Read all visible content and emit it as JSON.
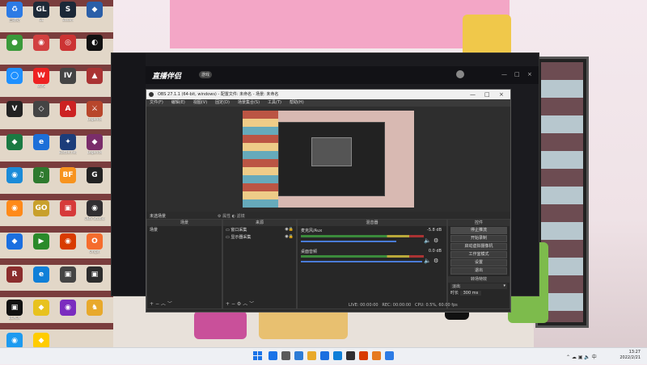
{
  "desktop_icons": [
    {
      "label": "回收站",
      "color": "#2c7be5",
      "glyph": "♻"
    },
    {
      "label": "GL",
      "color": "#1e2a38",
      "glyph": "GL"
    },
    {
      "label": "Steam",
      "color": "#1b2838",
      "glyph": "S"
    },
    {
      "label": "",
      "color": "#2b5fa8",
      "glyph": "◆"
    },
    {
      "label": "",
      "color": "#3a9a3a",
      "glyph": "●"
    },
    {
      "label": "",
      "color": "#d24040",
      "glyph": "◉"
    },
    {
      "label": "",
      "color": "#c33",
      "glyph": "◎"
    },
    {
      "label": "",
      "color": "#111",
      "glyph": "◐"
    },
    {
      "label": "",
      "color": "#1e90ff",
      "glyph": "◯"
    },
    {
      "label": "WPS",
      "color": "#e22",
      "glyph": "W"
    },
    {
      "label": "",
      "color": "#444",
      "glyph": "IV"
    },
    {
      "label": "",
      "color": "#a33",
      "glyph": "▲"
    },
    {
      "label": "",
      "color": "#222",
      "glyph": "V"
    },
    {
      "label": "",
      "color": "#444",
      "glyph": "◇"
    },
    {
      "label": "",
      "color": "#c22",
      "glyph": "A"
    },
    {
      "label": "Legends",
      "color": "#b8462b",
      "glyph": "⚔"
    },
    {
      "label": "",
      "color": "#1a7a42",
      "glyph": "◆"
    },
    {
      "label": "",
      "color": "#1d6fd8",
      "glyph": "e"
    },
    {
      "label": "Battle.net",
      "color": "#1c3d7a",
      "glyph": "✦"
    },
    {
      "label": "Legends",
      "color": "#7a2d6a",
      "glyph": "◆"
    },
    {
      "label": "",
      "color": "#1a8bd8",
      "glyph": "◉"
    },
    {
      "label": "",
      "color": "#2e7a2e",
      "glyph": "♫"
    },
    {
      "label": "",
      "color": "#f7931e",
      "glyph": "BF"
    },
    {
      "label": "",
      "color": "#222",
      "glyph": "G"
    },
    {
      "label": "",
      "color": "#ff8a1a",
      "glyph": "◉"
    },
    {
      "label": "",
      "color": "#c8a02c",
      "glyph": "GO"
    },
    {
      "label": "",
      "color": "#d63a3a",
      "glyph": "▣"
    },
    {
      "label": "OBS Studio",
      "color": "#302e31",
      "glyph": "◉"
    },
    {
      "label": "",
      "color": "#1b6fe0",
      "glyph": "◆"
    },
    {
      "label": "",
      "color": "#2a8a2a",
      "glyph": "▶"
    },
    {
      "label": "",
      "color": "#d83b01",
      "glyph": "◉"
    },
    {
      "label": "Origin",
      "color": "#f56c2d",
      "glyph": "O"
    },
    {
      "label": "",
      "color": "#8b2d2d",
      "glyph": "R"
    },
    {
      "label": "",
      "color": "#0f7fd8",
      "glyph": "e"
    },
    {
      "label": "",
      "color": "#444",
      "glyph": "▣"
    },
    {
      "label": "",
      "color": "#2c2c2c",
      "glyph": "▣"
    },
    {
      "label": "BLACK",
      "color": "#111",
      "glyph": "▣"
    },
    {
      "label": "",
      "color": "#e8c21e",
      "glyph": "◆"
    },
    {
      "label": "",
      "color": "#7b2cbf",
      "glyph": "◉"
    },
    {
      "label": "",
      "color": "#e8a92b",
      "glyph": "♞"
    },
    {
      "label": "",
      "color": "#1d9bf0",
      "glyph": "◉"
    },
    {
      "label": "",
      "color": "#ffcc00",
      "glyph": "◆"
    }
  ],
  "live_app": {
    "title": "直播伴侣",
    "badge": "游戏"
  },
  "obs": {
    "title": "OBS 27.1.1 (64-bit, windows) - 配置文件: 未命名 - 场景: 未命名",
    "menu": [
      "文件(F)",
      "编辑(E)",
      "视图(V)",
      "固定(D)",
      "场景集合(S)",
      "工具(T)",
      "帮助(H)"
    ],
    "scene_name": "未选场景",
    "mini_buttons": [
      "属性",
      "滤镜"
    ],
    "docks": {
      "scenes": {
        "title": "场景",
        "items": [
          "场景"
        ]
      },
      "sources": {
        "title": "来源",
        "items": [
          "窗口采集",
          "显示器采集"
        ]
      },
      "mixer": {
        "title": "混音器",
        "tracks": [
          {
            "name": "麦克风/Aux",
            "db": "-5.8 dB"
          },
          {
            "name": "桌面音频",
            "db": "0.0 dB"
          }
        ]
      },
      "controls": {
        "title": "控件",
        "buttons": [
          "停止推流",
          "开始录制",
          "启动虚拟摄像机",
          "工作室模式",
          "设置",
          "退出"
        ],
        "transitions_label": "转场特效",
        "transition_value": "淡出",
        "duration_label": "时长",
        "duration_value": "300 ms"
      }
    },
    "status": {
      "live": "LIVE: 00:00:00",
      "rec": "REC: 00:00:00",
      "cpu": "CPU: 0.5%, 60.00 fps"
    }
  },
  "taskbar": {
    "time": "13:27",
    "date": "2022/2/21",
    "apps": [
      {
        "color": "#1a73e8"
      },
      {
        "color": "#5b5b5b"
      },
      {
        "color": "#2d7cd6"
      },
      {
        "color": "#e8a92b"
      },
      {
        "color": "#1b6fe0"
      },
      {
        "color": "#0f7fd8"
      },
      {
        "color": "#302e31"
      },
      {
        "color": "#d83b01"
      },
      {
        "color": "#e67a1e"
      },
      {
        "color": "#2c7be5"
      }
    ]
  }
}
